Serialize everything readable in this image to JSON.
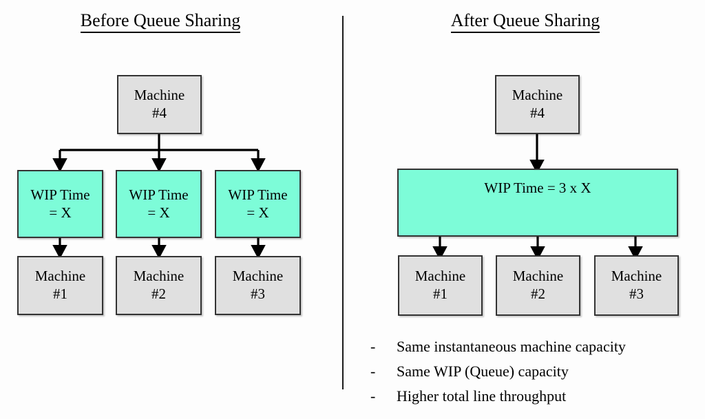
{
  "panels": {
    "before": {
      "title": "Before Queue Sharing",
      "top_node": {
        "label": "Machine\n#4"
      },
      "queues": [
        {
          "label": "WIP Time\n= X"
        },
        {
          "label": "WIP Time\n= X"
        },
        {
          "label": "WIP Time\n= X"
        }
      ],
      "machines": [
        {
          "label": "Machine\n#1"
        },
        {
          "label": "Machine\n#2"
        },
        {
          "label": "Machine\n#3"
        }
      ]
    },
    "after": {
      "title": "After Queue Sharing",
      "top_node": {
        "label": "Machine\n#4"
      },
      "shared_queue": {
        "label": "WIP Time = 3 x X"
      },
      "machines": [
        {
          "label": "Machine\n#1"
        },
        {
          "label": "Machine\n#2"
        },
        {
          "label": "Machine\n#3"
        }
      ],
      "benefits": [
        {
          "marker": "-",
          "text": "Same instantaneous machine capacity"
        },
        {
          "marker": "-",
          "text": "Same WIP (Queue) capacity"
        },
        {
          "marker": "-",
          "text": "Higher total line throughput"
        }
      ]
    }
  },
  "colors": {
    "queue_fill": "#7dfcd8",
    "machine_fill": "#e0e0e0",
    "border": "#333333",
    "connector": "#000000",
    "divider": "#1a1a1a",
    "text": "#000000"
  }
}
